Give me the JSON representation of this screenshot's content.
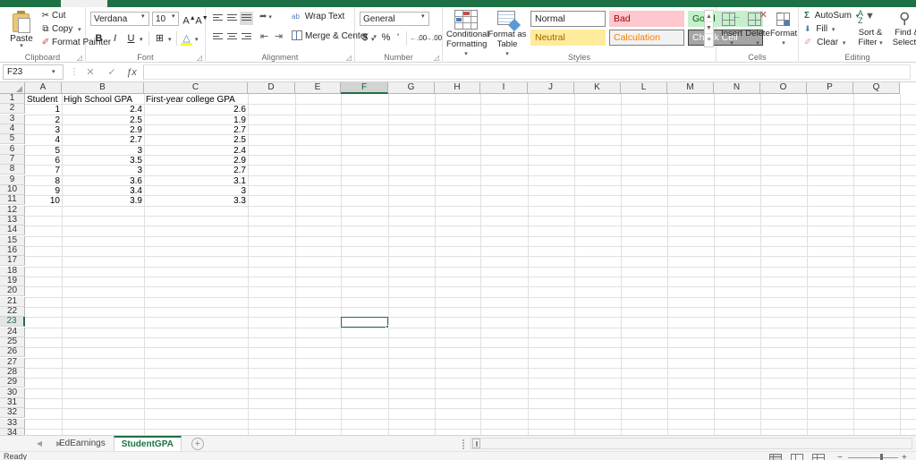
{
  "app": {
    "status_text": "Ready",
    "accent_color": "#1e7145"
  },
  "formula_bar": {
    "name_box_value": "F23",
    "formula_value": "",
    "cancel_icon": "✕",
    "confirm_icon": "✓",
    "function_icon": "ƒx",
    "separator_icon": "⋮"
  },
  "ribbon": {
    "groups": [
      {
        "name": "Clipboard",
        "label": "Clipboard"
      },
      {
        "name": "Font",
        "label": "Font"
      },
      {
        "name": "Alignment",
        "label": "Alignment"
      },
      {
        "name": "Number",
        "label": "Number"
      },
      {
        "name": "Styles",
        "label": "Styles"
      },
      {
        "name": "Cells",
        "label": "Cells"
      },
      {
        "name": "Editing",
        "label": "Editing"
      }
    ],
    "clipboard": {
      "paste_label": "Paste",
      "cut_label": "Cut",
      "copy_label": "Copy",
      "format_painter_label": "Format Painter",
      "cut_icon": "✂",
      "copy_icon": "⧉",
      "painter_icon": "✐"
    },
    "font": {
      "font_name": "Verdana",
      "font_size": "10",
      "grow_font_label": "A",
      "shrink_font_label": "A",
      "bold_label": "B",
      "italic_label": "I",
      "underline_label": "U",
      "borders_label": "⊞",
      "fill_color_label": "△",
      "font_color_label": "A"
    },
    "alignment": {
      "wrap_text_label": "Wrap Text",
      "merge_center_label": "Merge & Center",
      "orientation_icon": "➦",
      "indent_decrease_icon": "⇤",
      "indent_increase_icon": "⇥",
      "wrap_icon": "ab"
    },
    "number": {
      "format_value": "General",
      "currency_label": "$",
      "percent_label": "%",
      "comma_label": "'",
      "increase_decimal_label": ".00",
      "decrease_decimal_label": ".00"
    },
    "styles": {
      "conditional_formatting_label": "Conditional Formatting",
      "format_as_table_label": "Format as Table",
      "cell_styles": [
        {
          "name": "Normal",
          "label": "Normal",
          "bg": "#ffffff",
          "fg": "#262626",
          "border": "#8a8a8a"
        },
        {
          "name": "Bad",
          "label": "Bad",
          "bg": "#ffc7ce",
          "fg": "#9c0006",
          "border": "#ffc7ce"
        },
        {
          "name": "Good",
          "label": "Good",
          "bg": "#c6efce",
          "fg": "#006100",
          "border": "#c6efce"
        },
        {
          "name": "Neutral",
          "label": "Neutral",
          "bg": "#ffeb9c",
          "fg": "#9c6500",
          "border": "#ffeb9c"
        },
        {
          "name": "Calculation",
          "label": "Calculation",
          "bg": "#f2f2f2",
          "fg": "#fa7d00",
          "border": "#7f7f7f"
        },
        {
          "name": "Check Cell",
          "label": "Check Cell",
          "bg": "#a5a5a5",
          "fg": "#ffffff",
          "border": "#3f3f3f"
        }
      ],
      "scroll_up_icon": "▲",
      "scroll_down_icon": "▼",
      "more_icon": "≡"
    },
    "cells": {
      "insert_label": "Insert",
      "delete_label": "Delete",
      "format_label": "Format"
    },
    "editing": {
      "autosum_label": "AutoSum",
      "fill_label": "Fill",
      "clear_label": "Clear",
      "sort_filter_label": "Sort & Filter",
      "find_select_label": "Find & Select",
      "autosum_icon": "Σ",
      "fill_icon": "⬇",
      "clear_icon": "✐",
      "find_icon": "⚲"
    }
  },
  "grid": {
    "columns": [
      "A",
      "B",
      "C",
      "D",
      "E",
      "F",
      "G",
      "H",
      "I",
      "J",
      "K",
      "L",
      "M",
      "N",
      "O",
      "P",
      "Q"
    ],
    "selected_column": "F",
    "selected_row": 23,
    "selected_cell": "F23",
    "first_row": 1,
    "last_row": 34,
    "headers": {
      "A": "Student",
      "B": "High School GPA",
      "C": "First-year college GPA"
    },
    "rows": [
      {
        "row": 2,
        "student": "1",
        "hs_gpa": "2.4",
        "college_gpa": "2.6"
      },
      {
        "row": 3,
        "student": "2",
        "hs_gpa": "2.5",
        "college_gpa": "1.9"
      },
      {
        "row": 4,
        "student": "3",
        "hs_gpa": "2.9",
        "college_gpa": "2.7"
      },
      {
        "row": 5,
        "student": "4",
        "hs_gpa": "2.7",
        "college_gpa": "2.5"
      },
      {
        "row": 6,
        "student": "5",
        "hs_gpa": "3",
        "college_gpa": "2.4"
      },
      {
        "row": 7,
        "student": "6",
        "hs_gpa": "3.5",
        "college_gpa": "2.9"
      },
      {
        "row": 8,
        "student": "7",
        "hs_gpa": "3",
        "college_gpa": "2.7"
      },
      {
        "row": 9,
        "student": "8",
        "hs_gpa": "3.6",
        "college_gpa": "3.1"
      },
      {
        "row": 10,
        "student": "9",
        "hs_gpa": "3.4",
        "college_gpa": "3"
      },
      {
        "row": 11,
        "student": "10",
        "hs_gpa": "3.9",
        "college_gpa": "3.3"
      }
    ]
  },
  "sheet_tabs": {
    "prev_icon": "◀",
    "next_icon": "▶",
    "add_icon": "+",
    "tabs": [
      {
        "name": "EdEarnings",
        "label": "EdEarnings",
        "active": false
      },
      {
        "name": "StudentGPA",
        "label": "StudentGPA",
        "active": true
      }
    ]
  },
  "status_bar": {
    "ready_label": "Ready",
    "views": [
      "normal-view",
      "page-layout-view",
      "page-break-view"
    ],
    "zoom_minus": "−",
    "zoom_plus": "+"
  }
}
